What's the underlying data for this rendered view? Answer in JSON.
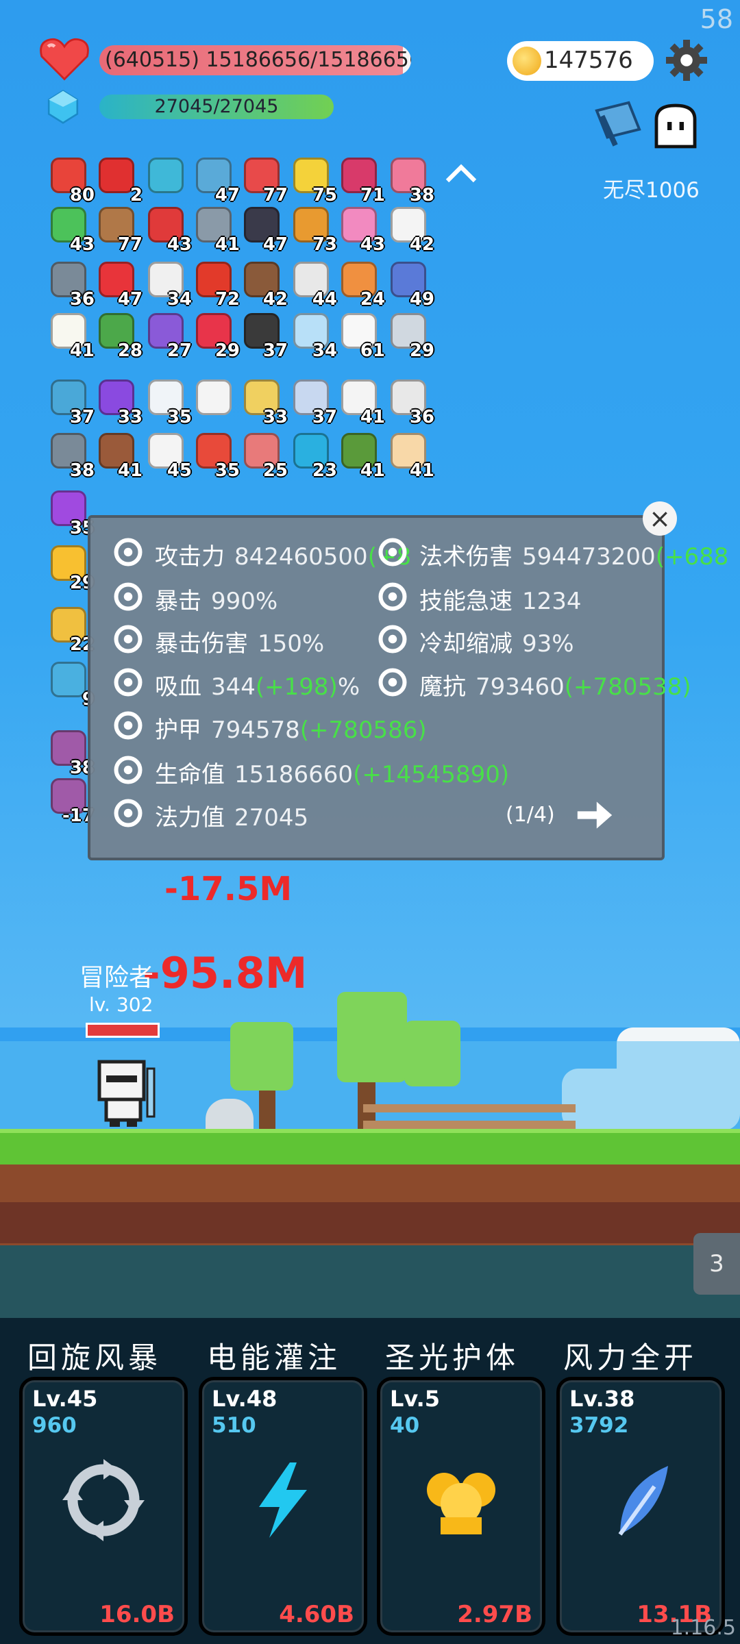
{
  "status": {
    "fps": "58",
    "hp_text": "(640515) 15186656/15186656",
    "mp_text": "27045/27045",
    "gold": "147576",
    "mode": "无尽1006"
  },
  "items": [
    {
      "icon": "sock-icon",
      "count": "80",
      "color": "#e8443a"
    },
    {
      "icon": "magnet-icon",
      "count": "2",
      "color": "#e03030"
    },
    {
      "icon": "magnifier-icon",
      "count": "",
      "color": "#3fb8d8"
    },
    {
      "icon": "potion-flask-icon",
      "count": "47",
      "color": "#5aaad8"
    },
    {
      "icon": "watermelon-icon",
      "count": "77",
      "color": "#e84a4a"
    },
    {
      "icon": "star-card-icon",
      "count": "75",
      "color": "#f4d23a"
    },
    {
      "icon": "jam-jar-icon",
      "count": "71",
      "color": "#d83a6a"
    },
    {
      "icon": "spray-bottle-icon",
      "count": "38",
      "color": "#f07a9a"
    },
    {
      "icon": "cash-heart-icon",
      "count": "43",
      "color": "#4cc25a"
    },
    {
      "icon": "donut-icon",
      "count": "77",
      "color": "#b07848"
    },
    {
      "icon": "mushroom-icon",
      "count": "43",
      "color": "#e03a3a"
    },
    {
      "icon": "elephant-icon",
      "count": "41",
      "color": "#8a9aa8"
    },
    {
      "icon": "bat-icon",
      "count": "47",
      "color": "#3a3a4a"
    },
    {
      "icon": "book-icon",
      "count": "73",
      "color": "#e89a30"
    },
    {
      "icon": "ice-cream-icon",
      "count": "43",
      "color": "#f28ac0"
    },
    {
      "icon": "ghost-icon",
      "count": "42",
      "color": "#f4f4f4"
    },
    {
      "icon": "spiked-ball-icon",
      "count": "36",
      "color": "#7a8a98"
    },
    {
      "icon": "strawberry-icon",
      "count": "47",
      "color": "#e8343a"
    },
    {
      "icon": "dice-icon",
      "count": "34",
      "color": "#f0f0f0"
    },
    {
      "icon": "apple-icon",
      "count": "72",
      "color": "#e23a2a"
    },
    {
      "icon": "coconut-icon",
      "count": "42",
      "color": "#8a5a3a"
    },
    {
      "icon": "thermometer-icon",
      "count": "44",
      "color": "#e8e8e8"
    },
    {
      "icon": "flag-pole-icon",
      "count": "24",
      "color": "#f09040"
    },
    {
      "icon": "shield-icon",
      "count": "49",
      "color": "#5a7ad8"
    },
    {
      "icon": "fried-egg-icon",
      "count": "41",
      "color": "#f8f8f0"
    },
    {
      "icon": "helmet-icon",
      "count": "28",
      "color": "#4ca84a"
    },
    {
      "icon": "star-shield-icon",
      "count": "27",
      "color": "#8a5ad8"
    },
    {
      "icon": "heart-icon",
      "count": "29",
      "color": "#e8344a"
    },
    {
      "icon": "bomb-pot-icon",
      "count": "37",
      "color": "#3a3a3a"
    },
    {
      "icon": "halo-wings-icon",
      "count": "34",
      "color": "#b8e0f8"
    },
    {
      "icon": "flower-icon",
      "count": "61",
      "color": "#f8f8f8"
    },
    {
      "icon": "stopwatch-icon",
      "count": "29",
      "color": "#d0d8e0"
    },
    {
      "icon": "scroll-icon",
      "count": "37",
      "color": "#4aa8d8"
    },
    {
      "icon": "purple-gift-icon",
      "count": "33",
      "color": "#8a4ae0"
    },
    {
      "icon": "cloud-icon",
      "count": "35",
      "color": "#f0f4f8"
    },
    {
      "icon": "notepad-icon",
      "count": "",
      "color": "#f4f4f4"
    },
    {
      "icon": "pencil-paper-icon",
      "count": "33",
      "color": "#f0d060"
    },
    {
      "icon": "pill-icon",
      "count": "37",
      "color": "#c8d8f0"
    },
    {
      "icon": "envelope-icon",
      "count": "41",
      "color": "#f4f4f4"
    },
    {
      "icon": "playing-cards-icon",
      "count": "36",
      "color": "#e8e8e8"
    },
    {
      "icon": "meteor-icon",
      "count": "38",
      "color": "#7a8a98"
    },
    {
      "icon": "door-icon",
      "count": "41",
      "color": "#9a5a3a"
    },
    {
      "icon": "clipboard-icon",
      "count": "45",
      "color": "#f4f4f4"
    },
    {
      "icon": "gift-box-icon",
      "count": "35",
      "color": "#e84a3a"
    },
    {
      "icon": "steak-icon",
      "count": "25",
      "color": "#e87a7a"
    },
    {
      "icon": "gem-icon",
      "count": "23",
      "color": "#2ab0e0"
    },
    {
      "icon": "green-potion-icon",
      "count": "41",
      "color": "#5a9a3a"
    },
    {
      "icon": "hand-icon",
      "count": "41",
      "color": "#f8d8a8"
    },
    {
      "icon": "purple-orb-icon",
      "count": "35",
      "color": "#a04ae0"
    },
    {
      "icon": "sunflower-icon",
      "count": "29",
      "color": "#f8c030"
    },
    {
      "icon": "ring-icon",
      "count": "22",
      "color": "#f0c040"
    },
    {
      "icon": "crosshair-icon",
      "count": "9",
      "color": "#4ab0e0"
    },
    {
      "icon": "staff-card-icon",
      "count": "38",
      "color": "#a05aa8"
    },
    {
      "icon": "sword-card-icon",
      "count": "-17",
      "color": "#a05aa8"
    }
  ],
  "stats": {
    "close_label": "×",
    "pager": "(1/4)",
    "rows_left": [
      {
        "icon": "axe-icon",
        "label": "攻击力",
        "value": "842460500",
        "plus": "(+8",
        "suffix": ""
      },
      {
        "icon": "crossed-blades-icon",
        "label": "暴击",
        "value": "990%",
        "plus": "",
        "suffix": ""
      },
      {
        "icon": "dotted-circle-icon",
        "label": "暴击伤害",
        "value": "150%",
        "plus": "",
        "suffix": ""
      },
      {
        "icon": "horned-skull-icon",
        "label": "吸血",
        "value": "344",
        "plus": "(+198)",
        "suffix": "%"
      },
      {
        "icon": "shield-outline-icon",
        "label": "护甲",
        "value": "794578",
        "plus": "(+780586)",
        "suffix": ""
      },
      {
        "icon": "heart-icon",
        "label": "生命值",
        "value": "15186660",
        "plus": "(+14545890)",
        "suffix": ""
      },
      {
        "icon": "crystal-icon",
        "label": "法力值",
        "value": "27045",
        "plus": "",
        "suffix": ""
      }
    ],
    "rows_right": [
      {
        "icon": "sun-icon",
        "label": "法术伤害",
        "value": "594473200",
        "plus": "(+688",
        "suffix": ""
      },
      {
        "icon": "lightning-icon",
        "label": "技能急速",
        "value": "1234",
        "plus": "",
        "suffix": ""
      },
      {
        "icon": "hourglass-icon",
        "label": "冷却缩减",
        "value": "93%",
        "plus": "",
        "suffix": ""
      },
      {
        "icon": "magic-shield-icon",
        "label": "魔抗",
        "value": "793460",
        "plus": "(+780538)",
        "suffix": ""
      }
    ]
  },
  "battle": {
    "hero_name": "冒险者",
    "hero_level": "lv. 302",
    "damage_big": "-95.8M",
    "damage_small": "-17.5M",
    "side_counter": "3"
  },
  "skills": [
    {
      "name": "回旋风暴",
      "level": "Lv.45",
      "cost": "960",
      "power": "16.0B",
      "icon": "cyclone-arrows-icon",
      "color": "#c8d0d8"
    },
    {
      "name": "电能灌注",
      "level": "Lv.48",
      "cost": "510",
      "power": "4.60B",
      "icon": "lightning-bolt-icon",
      "color": "#22c8f0"
    },
    {
      "name": "圣光护体",
      "level": "Lv.5",
      "cost": "40",
      "power": "2.97B",
      "icon": "golden-bells-icon",
      "color": "#f8b818"
    },
    {
      "name": "风力全开",
      "level": "Lv.38",
      "cost": "3792",
      "power": "13.1B",
      "icon": "feather-icon",
      "color": "#4a8ae8"
    }
  ],
  "version": "1.16.5"
}
